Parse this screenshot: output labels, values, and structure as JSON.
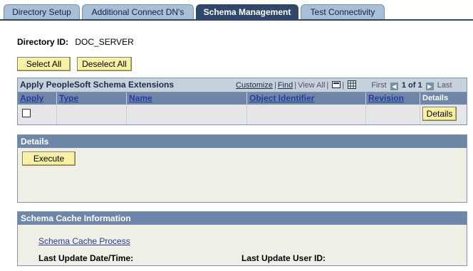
{
  "tabs": [
    {
      "label": "Directory Setup",
      "active": false
    },
    {
      "label": "Additional Connect DN's",
      "active": false
    },
    {
      "label": "Schema Management",
      "active": true
    },
    {
      "label": "Test Connectivity",
      "active": false
    }
  ],
  "directory": {
    "label": "Directory ID:",
    "value": "DOC_SERVER"
  },
  "buttons": {
    "select_all": "Select All",
    "deselect_all": "Deselect All"
  },
  "grid": {
    "title": "Apply PeopleSoft Schema Extensions",
    "nav": {
      "customize": "Customize",
      "find": "Find",
      "view_all": "View All",
      "first": "First",
      "range": "1 of 1",
      "last": "Last"
    },
    "columns": [
      "Apply",
      "Type",
      "Name",
      "Object Identifier",
      "Revision",
      "Details"
    ],
    "row": {
      "apply_checked": false,
      "type": "",
      "name": "",
      "object_identifier": "",
      "revision": "",
      "details_button": "Details"
    }
  },
  "details_panel": {
    "title": "Details",
    "execute": "Execute"
  },
  "cache_panel": {
    "title": "Schema Cache Information",
    "link": "Schema Cache Process",
    "last_update_label": "Last Update Date/Time:",
    "last_user_label": "Last Update User ID:"
  },
  "colors": {
    "tab_active": "#2f476b",
    "tab_inactive": "#a8bfd8",
    "header": "#6e87a8",
    "button": "#f8f0a2"
  }
}
